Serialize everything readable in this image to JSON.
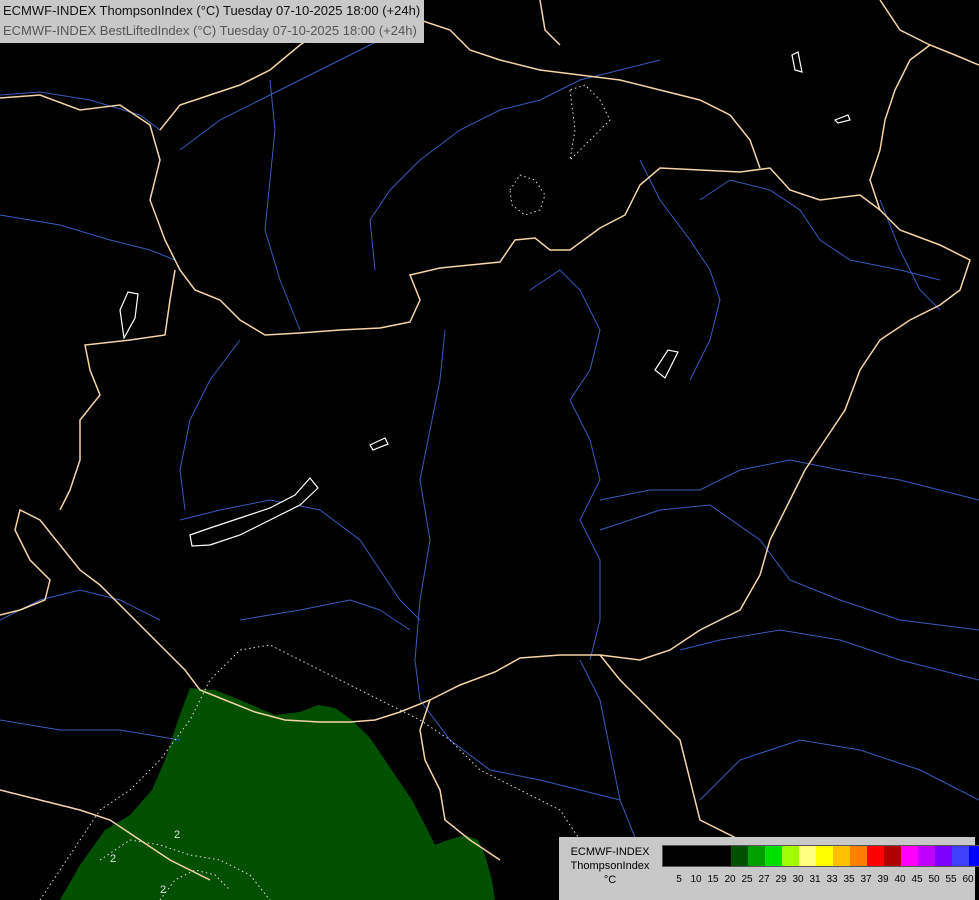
{
  "title": {
    "line1": "ECMWF-INDEX ThompsonIndex (°C) Tuesday 07-10-2025 18:00 (+24h)",
    "line2": "ECMWF-INDEX BestLiftedIndex (°C) Tuesday 07-10-2025 18:00 (+24h)"
  },
  "legend": {
    "label_line1": "ECMWF-INDEX",
    "label_line2": "ThompsonIndex",
    "label_line3": "°C",
    "colors": [
      "#000000",
      "#000000",
      "#000000",
      "#000000",
      "#005000",
      "#00a000",
      "#00e000",
      "#a0ff00",
      "#ffff80",
      "#ffff00",
      "#ffc000",
      "#ff8000",
      "#ff0000",
      "#b00000",
      "#ff00ff",
      "#c000ff",
      "#8000ff",
      "#4040ff",
      "#0000ff"
    ],
    "ticks": [
      "5",
      "10",
      "15",
      "20",
      "25",
      "27",
      "29",
      "30",
      "31",
      "33",
      "35",
      "37",
      "39",
      "40",
      "45",
      "50",
      "55",
      "60"
    ]
  },
  "contour_labels": [
    "2",
    "2",
    "2"
  ],
  "colors": {
    "background": "#000000",
    "borders": "#f5d4a8",
    "rivers": "#3a5bbf",
    "filled_region": "#005000"
  }
}
